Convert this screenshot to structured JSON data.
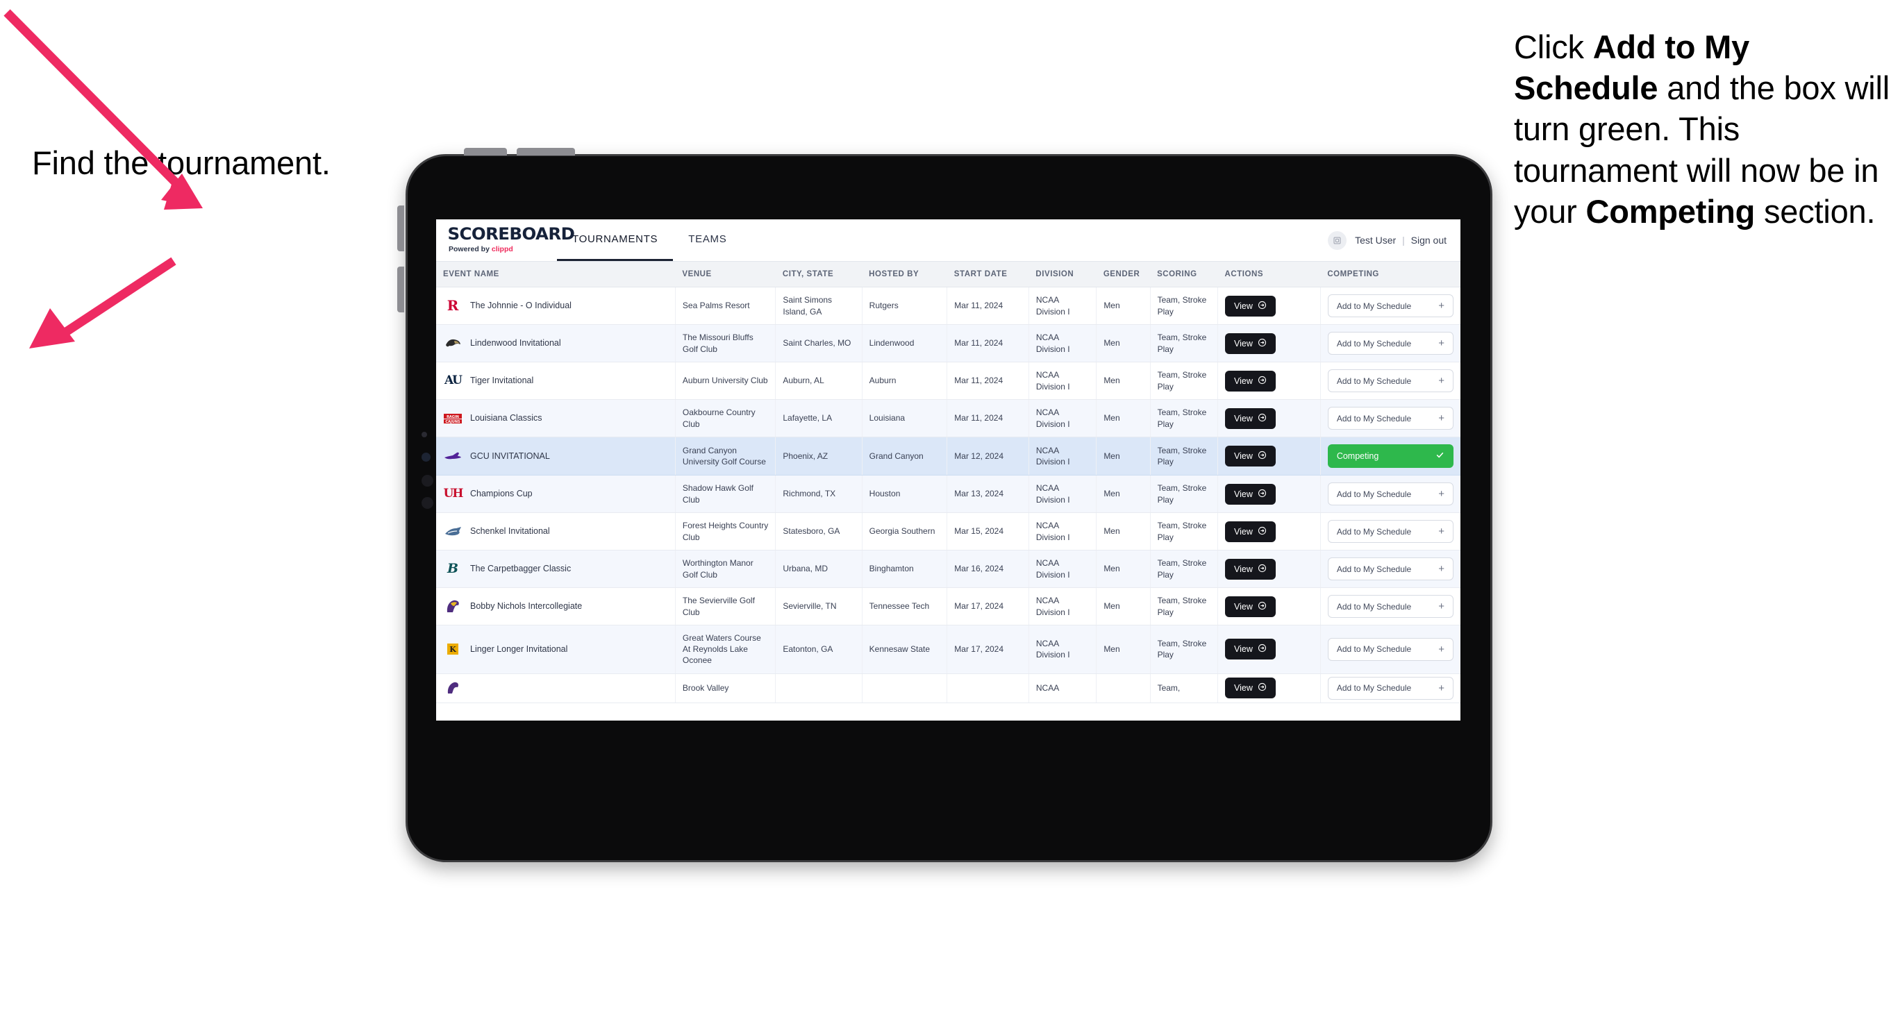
{
  "annotations": {
    "left": "Find the tournament.",
    "right_parts": [
      {
        "t": "Click ",
        "b": false
      },
      {
        "t": "Add to My Schedule",
        "b": true
      },
      {
        "t": " and the box will turn green. This tournament will now be in your ",
        "b": false
      },
      {
        "t": "Competing",
        "b": true
      },
      {
        "t": " section.",
        "b": false
      }
    ],
    "arrow_color": "#ee2a62"
  },
  "app": {
    "brand": {
      "title": "SCOREBOARD",
      "powered_prefix": "Powered by ",
      "powered_name": "clippd",
      "accent": "#ef2b5c"
    },
    "nav": [
      {
        "label": "TOURNAMENTS",
        "active": true
      },
      {
        "label": "TEAMS",
        "active": false
      }
    ],
    "account": {
      "avatar_icon": "user-avatar-icon",
      "user_name": "Test User",
      "separator": "|",
      "sign_out": "Sign out"
    }
  },
  "table": {
    "columns": [
      "EVENT NAME",
      "VENUE",
      "CITY, STATE",
      "HOSTED BY",
      "START DATE",
      "DIVISION",
      "GENDER",
      "SCORING",
      "ACTIONS",
      "COMPETING"
    ],
    "view_label": "View",
    "add_label": "Add to My Schedule",
    "add_icon": "+",
    "competing_label": "Competing",
    "competing_color": "#2eb84c",
    "rows": [
      {
        "logo": "rutgers-r-logo",
        "event": "The Johnnie - O Individual",
        "venue": "Sea Palms Resort",
        "city": "Saint Simons Island, GA",
        "host": "Rutgers",
        "date": "Mar 11, 2024",
        "division": "NCAA Division I",
        "gender": "Men",
        "scoring": "Team, Stroke Play",
        "competing": false
      },
      {
        "logo": "lindenwood-lion-logo",
        "event": "Lindenwood Invitational",
        "venue": "The Missouri Bluffs Golf Club",
        "city": "Saint Charles, MO",
        "host": "Lindenwood",
        "date": "Mar 11, 2024",
        "division": "NCAA Division I",
        "gender": "Men",
        "scoring": "Team, Stroke Play",
        "competing": false
      },
      {
        "logo": "auburn-au-logo",
        "event": "Tiger Invitational",
        "venue": "Auburn University Club",
        "city": "Auburn, AL",
        "host": "Auburn",
        "date": "Mar 11, 2024",
        "division": "NCAA Division I",
        "gender": "Men",
        "scoring": "Team, Stroke Play",
        "competing": false
      },
      {
        "logo": "ragin-cajuns-logo",
        "event": "Louisiana Classics",
        "venue": "Oakbourne Country Club",
        "city": "Lafayette, LA",
        "host": "Louisiana",
        "date": "Mar 11, 2024",
        "division": "NCAA Division I",
        "gender": "Men",
        "scoring": "Team, Stroke Play",
        "competing": false
      },
      {
        "logo": "gcu-lope-logo",
        "event": "GCU INVITATIONAL",
        "venue": "Grand Canyon University Golf Course",
        "city": "Phoenix, AZ",
        "host": "Grand Canyon",
        "date": "Mar 12, 2024",
        "division": "NCAA Division I",
        "gender": "Men",
        "scoring": "Team, Stroke Play",
        "competing": true
      },
      {
        "logo": "houston-uh-logo",
        "event": "Champions Cup",
        "venue": "Shadow Hawk Golf Club",
        "city": "Richmond, TX",
        "host": "Houston",
        "date": "Mar 13, 2024",
        "division": "NCAA Division I",
        "gender": "Men",
        "scoring": "Team, Stroke Play",
        "competing": false
      },
      {
        "logo": "georgia-southern-eagle-logo",
        "event": "Schenkel Invitational",
        "venue": "Forest Heights Country Club",
        "city": "Statesboro, GA",
        "host": "Georgia Southern",
        "date": "Mar 15, 2024",
        "division": "NCAA Division I",
        "gender": "Men",
        "scoring": "Team, Stroke Play",
        "competing": false
      },
      {
        "logo": "binghamton-b-logo",
        "event": "The Carpetbagger Classic",
        "venue": "Worthington Manor Golf Club",
        "city": "Urbana, MD",
        "host": "Binghamton",
        "date": "Mar 16, 2024",
        "division": "NCAA Division I",
        "gender": "Men",
        "scoring": "Team, Stroke Play",
        "competing": false
      },
      {
        "logo": "tennessee-tech-eagle-logo",
        "event": "Bobby Nichols Intercollegiate",
        "venue": "The Sevierville Golf Club",
        "city": "Sevierville, TN",
        "host": "Tennessee Tech",
        "date": "Mar 17, 2024",
        "division": "NCAA Division I",
        "gender": "Men",
        "scoring": "Team, Stroke Play",
        "competing": false
      },
      {
        "logo": "kennesaw-state-logo",
        "event": "Linger Longer Invitational",
        "venue": "Great Waters Course At Reynolds Lake Oconee",
        "city": "Eatonton, GA",
        "host": "Kennesaw State",
        "date": "Mar 17, 2024",
        "division": "NCAA Division I",
        "gender": "Men",
        "scoring": "Team, Stroke Play",
        "competing": false
      },
      {
        "logo": "partial-row-logo",
        "event": "",
        "venue": "Brook Valley",
        "city": "",
        "host": "",
        "date": "",
        "division": "NCAA",
        "gender": "",
        "scoring": "Team,",
        "competing": false,
        "partial": true
      }
    ]
  }
}
